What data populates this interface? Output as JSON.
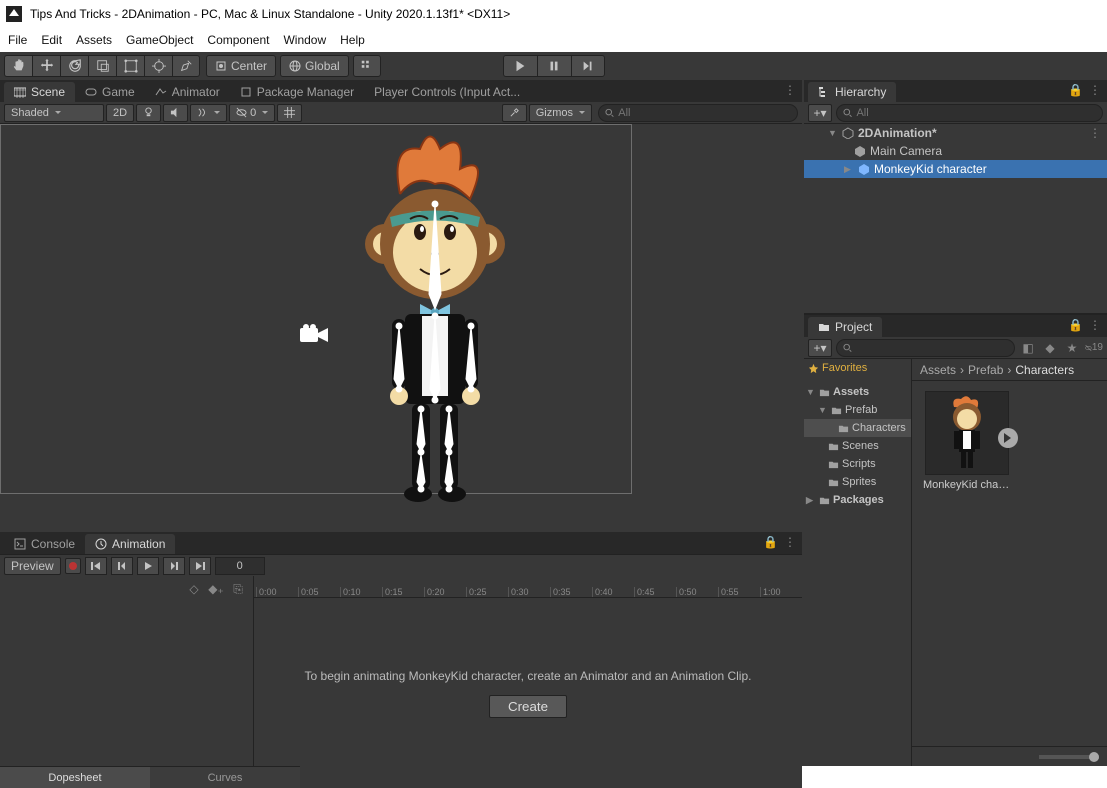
{
  "window": {
    "title": "Tips And Tricks - 2DAnimation - PC, Mac & Linux Standalone - Unity 2020.1.13f1* <DX11>"
  },
  "menu": [
    "File",
    "Edit",
    "Assets",
    "GameObject",
    "Component",
    "Window",
    "Help"
  ],
  "toolbar": {
    "center": "Center",
    "global": "Global"
  },
  "tabs": {
    "scene": "Scene",
    "game": "Game",
    "animator": "Animator",
    "pkg": "Package Manager",
    "input": "Player Controls (Input Act..."
  },
  "scene_tools": {
    "shading": "Shaded",
    "mode2d": "2D",
    "gizmos": "Gizmos",
    "search_ph": "All",
    "lights_count": "0"
  },
  "bottom_tabs": {
    "console": "Console",
    "animation": "Animation"
  },
  "anim": {
    "preview": "Preview",
    "frame": "0",
    "ruler": [
      "0:00",
      "0:05",
      "0:10",
      "0:15",
      "0:20",
      "0:25",
      "0:30",
      "0:35",
      "0:40",
      "0:45",
      "0:50",
      "0:55",
      "1:00"
    ],
    "msg": "To begin animating MonkeyKid character, create an Animator and an Animation Clip.",
    "create": "Create",
    "dopesheet": "Dopesheet",
    "curves": "Curves"
  },
  "hierarchy": {
    "title": "Hierarchy",
    "search_ph": "All",
    "scene": "2DAnimation*",
    "items": [
      "Main Camera",
      "MonkeyKid character"
    ]
  },
  "project": {
    "title": "Project",
    "hidden_count": "19",
    "favorites": "Favorites",
    "assets": "Assets",
    "prefab": "Prefab",
    "characters": "Characters",
    "scenes": "Scenes",
    "scripts": "Scripts",
    "sprites": "Sprites",
    "packages": "Packages",
    "crumb": [
      "Assets",
      "Prefab",
      "Characters"
    ],
    "asset_name": "MonkeyKid chara..."
  }
}
